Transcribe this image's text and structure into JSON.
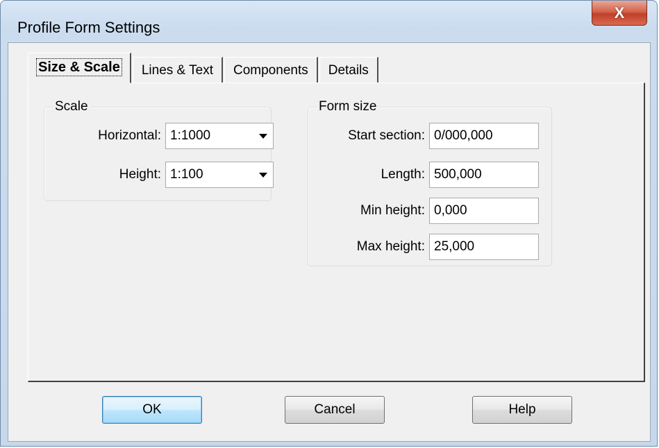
{
  "window": {
    "title": "Profile Form Settings",
    "close_label": "X"
  },
  "tabs": [
    {
      "label": "Size & Scale",
      "active": true
    },
    {
      "label": "Lines & Text",
      "active": false
    },
    {
      "label": "Components",
      "active": false
    },
    {
      "label": "Details",
      "active": false
    }
  ],
  "scale": {
    "legend": "Scale",
    "horizontal_label": "Horizontal:",
    "horizontal_value": "1:1000",
    "height_label": "Height:",
    "height_value": "1:100"
  },
  "form_size": {
    "legend": "Form size",
    "start_section_label": "Start section:",
    "start_section_value": "0/000,000",
    "length_label": "Length:",
    "length_value": "500,000",
    "min_height_label": "Min height:",
    "min_height_value": "0,000",
    "max_height_label": "Max height:",
    "max_height_value": "25,000"
  },
  "buttons": {
    "ok": "OK",
    "cancel": "Cancel",
    "help": "Help"
  },
  "colors": {
    "default_button": "#bee6fd",
    "close_button": "#c0402a"
  }
}
